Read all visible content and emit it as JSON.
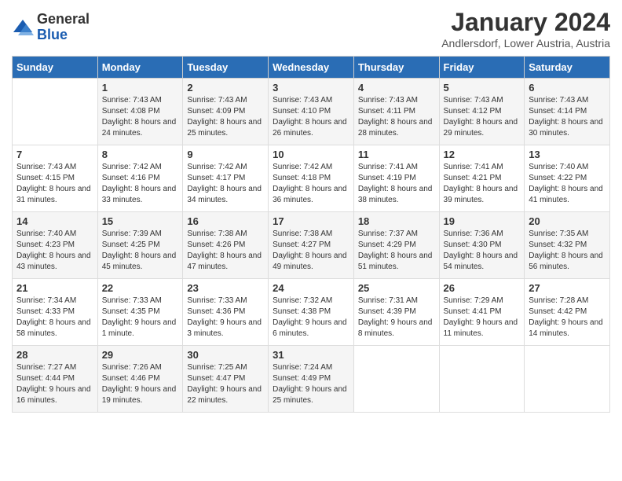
{
  "logo": {
    "general": "General",
    "blue": "Blue"
  },
  "title": "January 2024",
  "subtitle": "Andlersdorf, Lower Austria, Austria",
  "weekdays": [
    "Sunday",
    "Monday",
    "Tuesday",
    "Wednesday",
    "Thursday",
    "Friday",
    "Saturday"
  ],
  "weeks": [
    [
      {
        "day": "",
        "sunrise": "",
        "sunset": "",
        "daylight": ""
      },
      {
        "day": "1",
        "sunrise": "Sunrise: 7:43 AM",
        "sunset": "Sunset: 4:08 PM",
        "daylight": "Daylight: 8 hours and 24 minutes."
      },
      {
        "day": "2",
        "sunrise": "Sunrise: 7:43 AM",
        "sunset": "Sunset: 4:09 PM",
        "daylight": "Daylight: 8 hours and 25 minutes."
      },
      {
        "day": "3",
        "sunrise": "Sunrise: 7:43 AM",
        "sunset": "Sunset: 4:10 PM",
        "daylight": "Daylight: 8 hours and 26 minutes."
      },
      {
        "day": "4",
        "sunrise": "Sunrise: 7:43 AM",
        "sunset": "Sunset: 4:11 PM",
        "daylight": "Daylight: 8 hours and 28 minutes."
      },
      {
        "day": "5",
        "sunrise": "Sunrise: 7:43 AM",
        "sunset": "Sunset: 4:12 PM",
        "daylight": "Daylight: 8 hours and 29 minutes."
      },
      {
        "day": "6",
        "sunrise": "Sunrise: 7:43 AM",
        "sunset": "Sunset: 4:14 PM",
        "daylight": "Daylight: 8 hours and 30 minutes."
      }
    ],
    [
      {
        "day": "7",
        "sunrise": "Sunrise: 7:43 AM",
        "sunset": "Sunset: 4:15 PM",
        "daylight": "Daylight: 8 hours and 31 minutes."
      },
      {
        "day": "8",
        "sunrise": "Sunrise: 7:42 AM",
        "sunset": "Sunset: 4:16 PM",
        "daylight": "Daylight: 8 hours and 33 minutes."
      },
      {
        "day": "9",
        "sunrise": "Sunrise: 7:42 AM",
        "sunset": "Sunset: 4:17 PM",
        "daylight": "Daylight: 8 hours and 34 minutes."
      },
      {
        "day": "10",
        "sunrise": "Sunrise: 7:42 AM",
        "sunset": "Sunset: 4:18 PM",
        "daylight": "Daylight: 8 hours and 36 minutes."
      },
      {
        "day": "11",
        "sunrise": "Sunrise: 7:41 AM",
        "sunset": "Sunset: 4:19 PM",
        "daylight": "Daylight: 8 hours and 38 minutes."
      },
      {
        "day": "12",
        "sunrise": "Sunrise: 7:41 AM",
        "sunset": "Sunset: 4:21 PM",
        "daylight": "Daylight: 8 hours and 39 minutes."
      },
      {
        "day": "13",
        "sunrise": "Sunrise: 7:40 AM",
        "sunset": "Sunset: 4:22 PM",
        "daylight": "Daylight: 8 hours and 41 minutes."
      }
    ],
    [
      {
        "day": "14",
        "sunrise": "Sunrise: 7:40 AM",
        "sunset": "Sunset: 4:23 PM",
        "daylight": "Daylight: 8 hours and 43 minutes."
      },
      {
        "day": "15",
        "sunrise": "Sunrise: 7:39 AM",
        "sunset": "Sunset: 4:25 PM",
        "daylight": "Daylight: 8 hours and 45 minutes."
      },
      {
        "day": "16",
        "sunrise": "Sunrise: 7:38 AM",
        "sunset": "Sunset: 4:26 PM",
        "daylight": "Daylight: 8 hours and 47 minutes."
      },
      {
        "day": "17",
        "sunrise": "Sunrise: 7:38 AM",
        "sunset": "Sunset: 4:27 PM",
        "daylight": "Daylight: 8 hours and 49 minutes."
      },
      {
        "day": "18",
        "sunrise": "Sunrise: 7:37 AM",
        "sunset": "Sunset: 4:29 PM",
        "daylight": "Daylight: 8 hours and 51 minutes."
      },
      {
        "day": "19",
        "sunrise": "Sunrise: 7:36 AM",
        "sunset": "Sunset: 4:30 PM",
        "daylight": "Daylight: 8 hours and 54 minutes."
      },
      {
        "day": "20",
        "sunrise": "Sunrise: 7:35 AM",
        "sunset": "Sunset: 4:32 PM",
        "daylight": "Daylight: 8 hours and 56 minutes."
      }
    ],
    [
      {
        "day": "21",
        "sunrise": "Sunrise: 7:34 AM",
        "sunset": "Sunset: 4:33 PM",
        "daylight": "Daylight: 8 hours and 58 minutes."
      },
      {
        "day": "22",
        "sunrise": "Sunrise: 7:33 AM",
        "sunset": "Sunset: 4:35 PM",
        "daylight": "Daylight: 9 hours and 1 minute."
      },
      {
        "day": "23",
        "sunrise": "Sunrise: 7:33 AM",
        "sunset": "Sunset: 4:36 PM",
        "daylight": "Daylight: 9 hours and 3 minutes."
      },
      {
        "day": "24",
        "sunrise": "Sunrise: 7:32 AM",
        "sunset": "Sunset: 4:38 PM",
        "daylight": "Daylight: 9 hours and 6 minutes."
      },
      {
        "day": "25",
        "sunrise": "Sunrise: 7:31 AM",
        "sunset": "Sunset: 4:39 PM",
        "daylight": "Daylight: 9 hours and 8 minutes."
      },
      {
        "day": "26",
        "sunrise": "Sunrise: 7:29 AM",
        "sunset": "Sunset: 4:41 PM",
        "daylight": "Daylight: 9 hours and 11 minutes."
      },
      {
        "day": "27",
        "sunrise": "Sunrise: 7:28 AM",
        "sunset": "Sunset: 4:42 PM",
        "daylight": "Daylight: 9 hours and 14 minutes."
      }
    ],
    [
      {
        "day": "28",
        "sunrise": "Sunrise: 7:27 AM",
        "sunset": "Sunset: 4:44 PM",
        "daylight": "Daylight: 9 hours and 16 minutes."
      },
      {
        "day": "29",
        "sunrise": "Sunrise: 7:26 AM",
        "sunset": "Sunset: 4:46 PM",
        "daylight": "Daylight: 9 hours and 19 minutes."
      },
      {
        "day": "30",
        "sunrise": "Sunrise: 7:25 AM",
        "sunset": "Sunset: 4:47 PM",
        "daylight": "Daylight: 9 hours and 22 minutes."
      },
      {
        "day": "31",
        "sunrise": "Sunrise: 7:24 AM",
        "sunset": "Sunset: 4:49 PM",
        "daylight": "Daylight: 9 hours and 25 minutes."
      },
      {
        "day": "",
        "sunrise": "",
        "sunset": "",
        "daylight": ""
      },
      {
        "day": "",
        "sunrise": "",
        "sunset": "",
        "daylight": ""
      },
      {
        "day": "",
        "sunrise": "",
        "sunset": "",
        "daylight": ""
      }
    ]
  ]
}
